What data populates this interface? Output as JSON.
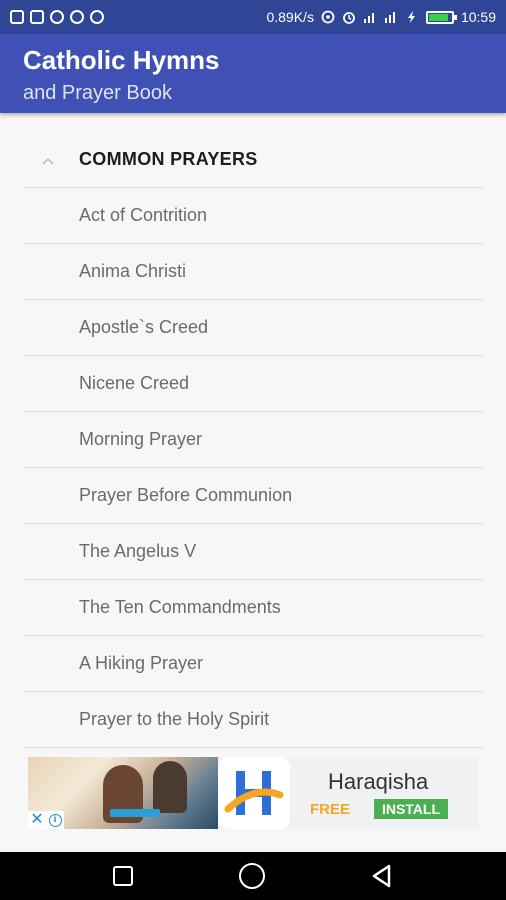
{
  "status_bar": {
    "speed": "0.89K/s",
    "time": "10:59",
    "icons": [
      "shield-icon",
      "cast-icon",
      "vpn-icon",
      "hotspot-icon",
      "sync-icon",
      "nfc-icon",
      "alarm-icon",
      "signal-icon",
      "wifi-icon",
      "charging-icon",
      "battery-icon"
    ],
    "battery_level": 0.85,
    "battery_color": "#36d04b"
  },
  "app_bar": {
    "title": "Catholic Hymns",
    "subtitle": "and Prayer Book",
    "color": "#3f51b5"
  },
  "section": {
    "title": "COMMON PRAYERS",
    "expanded": true,
    "items": [
      "Act of Contrition",
      "Anima Christi",
      "Apostle`s Creed",
      "Nicene Creed",
      "Morning Prayer",
      "Prayer Before Communion",
      "The Angelus V",
      "The Ten Commandments",
      "A Hiking Prayer",
      "Prayer to the Holy Spirit"
    ]
  },
  "ad": {
    "app_name": "Haraqisha",
    "price": "FREE",
    "install_label": "INSTALL",
    "close_glyph": "✕",
    "info_glyph": "i"
  },
  "nav_bar": {
    "icons": [
      "recent-apps-icon",
      "home-icon",
      "back-icon"
    ]
  }
}
